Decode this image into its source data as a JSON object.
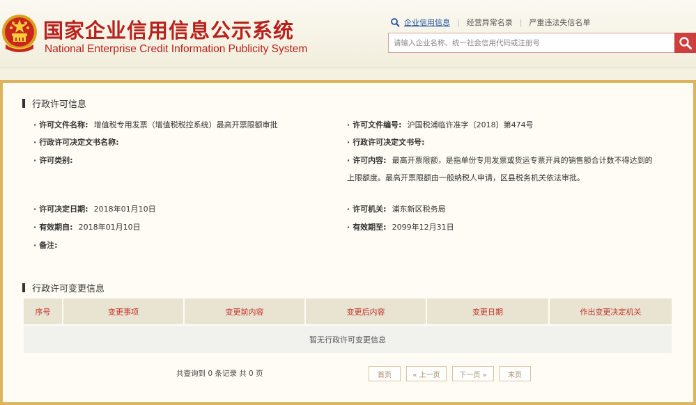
{
  "header": {
    "title_cn": "国家企业信用信息公示系统",
    "title_en": "National Enterprise Credit Information Publicity System",
    "nav_links": [
      "企业信用信息",
      "经营异常名录",
      "严重违法失信名单"
    ],
    "search_placeholder": "请输入企业名称、统一社会信用代码或注册号",
    "accent_color": "#b7211b"
  },
  "license_section": {
    "title": "行政许可信息",
    "fields": {
      "doc_name_label": "许可文件名称:",
      "doc_name_value": "增值税专用发票（增值税税控系统）最高开票限额审批",
      "doc_no_label": "许可文件编号:",
      "doc_no_value": "沪国税浦临许准字〔2018〕第474号",
      "decision_doc_name_label": "行政许可决定文书名称:",
      "decision_doc_name_value": "",
      "decision_doc_no_label": "行政许可决定文书号:",
      "decision_doc_no_value": "",
      "category_label": "许可类别:",
      "category_value": "",
      "content_label": "许可内容:",
      "content_value": "最高开票限额，是指单份专用发票或货运专票开具的销售额合计数不得达到的上限额度。最高开票限额由一般纳税人申请，区县税务机关依法审批。",
      "decision_date_label": "许可决定日期:",
      "decision_date_value": "2018年01月10日",
      "authority_label": "许可机关:",
      "authority_value": "浦东新区税务局",
      "valid_from_label": "有效期自:",
      "valid_from_value": "2018年01月10日",
      "valid_to_label": "有效期至:",
      "valid_to_value": "2099年12月31日",
      "remarks_label": "备注:",
      "remarks_value": ""
    }
  },
  "change_section": {
    "title": "行政许可变更信息",
    "columns": [
      "序号",
      "变更事项",
      "变更前内容",
      "变更后内容",
      "变更日期",
      "作出变更决定机关"
    ],
    "empty_text": "暂无行政许可变更信息"
  },
  "pagination": {
    "info": "共查询到 0 条记录 共 0 页",
    "first": "首页",
    "prev": "« 上一页",
    "next": "下一页 »",
    "last": "末页"
  }
}
